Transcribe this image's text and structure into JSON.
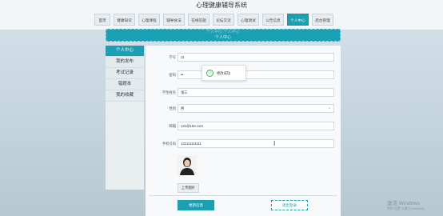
{
  "site_title": "心理健康辅导系统",
  "nav": [
    {
      "label": "首页",
      "w": 20
    },
    {
      "label": "健康知识",
      "w": 27
    },
    {
      "label": "心理课程",
      "w": 27
    },
    {
      "label": "辅导食法",
      "w": 27
    },
    {
      "label": "在线答题",
      "w": 27
    },
    {
      "label": "论坛交流",
      "w": 27
    },
    {
      "label": "心理测试",
      "w": 27
    },
    {
      "label": "公告信息",
      "w": 27
    },
    {
      "label": "个人中心",
      "w": 27,
      "active": true
    },
    {
      "label": "后台管理",
      "w": 27
    }
  ],
  "banner": {
    "line1": "个人中心 个人中心",
    "line2": "个人中心"
  },
  "sidebar": {
    "head": "个人中心",
    "items": [
      "我的发布",
      "考试记录",
      "错题本",
      "我的收藏"
    ]
  },
  "form": {
    "student_id": {
      "label": "学号",
      "value": "11"
    },
    "password": {
      "label": "密码",
      "value": "••"
    },
    "name": {
      "label": "学生姓名",
      "value": "张三"
    },
    "gender": {
      "label": "性别",
      "value": "男"
    },
    "email": {
      "label": "邮箱",
      "value": "131@163.com"
    },
    "phone": {
      "label": "手机号码",
      "value": "131111111111"
    }
  },
  "toast": {
    "text": "修改成功"
  },
  "buttons": {
    "upload": "上传图片",
    "update": "更新信息",
    "logout": "退出登录"
  },
  "watermark": {
    "line1": "激活 Windows",
    "line2": "转到“设置”以激活 Windows。"
  },
  "colors": {
    "accent": "#1aa0b3",
    "success": "#39b54a"
  }
}
